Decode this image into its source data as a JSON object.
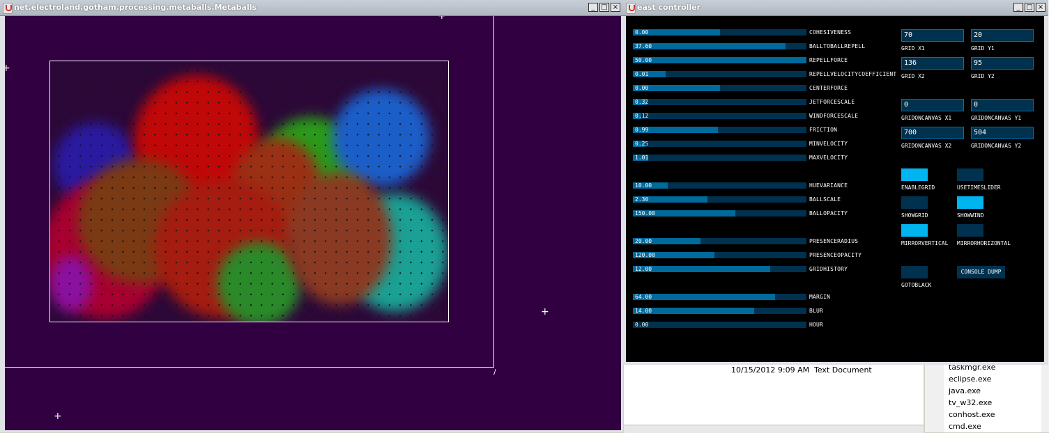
{
  "left_window": {
    "title": "net.electroland.gotham.processing.metaballs.Metaballs",
    "buttons": {
      "minimize": "_",
      "maximize": "□",
      "close": "×"
    }
  },
  "right_window": {
    "title": "east controller",
    "buttons": {
      "minimize": "_",
      "maximize": "□",
      "close": "×"
    }
  },
  "sliders": [
    {
      "label": "COHESIVENESS",
      "value": "0.00",
      "fill": 0.5
    },
    {
      "label": "BALLTOBALLREPELL",
      "value": "37.60",
      "fill": 0.88
    },
    {
      "label": "REPELLFORCE",
      "value": "50.00",
      "fill": 1.0
    },
    {
      "label": "REPELLVELOCITYCOEFFICIENT",
      "value": "0.01",
      "fill": 0.19
    },
    {
      "label": "CENTERFORCE",
      "value": "0.00",
      "fill": 0.5
    },
    {
      "label": "JETFORCESCALE",
      "value": "0.32",
      "fill": 0.08
    },
    {
      "label": "WINDFORCESCALE",
      "value": "0.12",
      "fill": 0.05
    },
    {
      "label": "FRICTION",
      "value": "0.99",
      "fill": 0.49
    },
    {
      "label": "MINVELOCITY",
      "value": "0.25",
      "fill": 0.07
    },
    {
      "label": "MAXVELOCITY",
      "value": "1.01",
      "fill": 0.09
    },
    {
      "label": "HUEVARIANCE",
      "value": "10.00",
      "fill": 0.2
    },
    {
      "label": "BALLSCALE",
      "value": "2.30",
      "fill": 0.43
    },
    {
      "label": "BALLOPACITY",
      "value": "150.00",
      "fill": 0.59
    },
    {
      "label": "PRESENCERADIUS",
      "value": "20.00",
      "fill": 0.39
    },
    {
      "label": "PRESENCEOPACITY",
      "value": "120.00",
      "fill": 0.47
    },
    {
      "label": "GRIDHISTORY",
      "value": "12.00",
      "fill": 0.79
    },
    {
      "label": "MARGIN",
      "value": "64.00",
      "fill": 0.82
    },
    {
      "label": "BLUR",
      "value": "14.00",
      "fill": 0.7
    },
    {
      "label": "HOUR",
      "value": "0.00",
      "fill": 0.0
    }
  ],
  "number_fields": [
    {
      "label": "GRID X1",
      "value": "70"
    },
    {
      "label": "GRID Y1",
      "value": "20"
    },
    {
      "label": "GRID X2",
      "value": "136"
    },
    {
      "label": "GRID Y2",
      "value": "95"
    },
    {
      "label": "GRIDONCANVAS X1",
      "value": "0"
    },
    {
      "label": "GRIDONCANVAS Y1",
      "value": "0"
    },
    {
      "label": "GRIDONCANVAS X2",
      "value": "700"
    },
    {
      "label": "GRIDONCANVAS Y2",
      "value": "504"
    }
  ],
  "toggles": [
    {
      "label": "ENABLEGRID",
      "on": true
    },
    {
      "label": "USETIMESLIDER",
      "on": false
    },
    {
      "label": "SHOWGRID",
      "on": false
    },
    {
      "label": "SHOWWIND",
      "on": true
    },
    {
      "label": "MIRRORVERTICAL",
      "on": true
    },
    {
      "label": "MIRRORHORIZONTAL",
      "on": false
    },
    {
      "label": "GOTOBLACK",
      "on": false
    }
  ],
  "console_button": "CONSOLE DUMP",
  "colors": {
    "on": "#00b4f0",
    "off": "#00324f",
    "fill": "#006a9c"
  },
  "file_row": {
    "date": "10/15/2012 9:09 AM",
    "type": "Text Document"
  },
  "processes": [
    "taskmgr.exe",
    "eclipse.exe",
    "java.exe",
    "tv_w32.exe",
    "conhost.exe",
    "cmd.exe"
  ],
  "canvas_mark": "/",
  "cursor_glyph": "+"
}
